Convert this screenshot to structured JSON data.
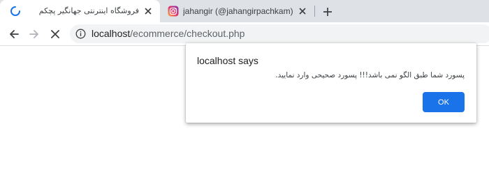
{
  "tabs": [
    {
      "title": "فروشگاه اینترنتی جهانگیر پچکم",
      "state": "loading",
      "icon": "spinner-icon"
    },
    {
      "title": "jahangir (@jahangirpachkam) • Instagram",
      "icon": "instagram-icon"
    }
  ],
  "toolbar": {
    "url_host": "localhost",
    "url_path": "/ecommerce/checkout.php",
    "icons": [
      "back-arrow-icon",
      "forward-arrow-icon",
      "stop-icon",
      "info-icon"
    ]
  },
  "dialog": {
    "title": "localhost says",
    "message": "پسورد شما طبق الگو نمی باشد!!! پسورد صحیحی وارد نمایید.",
    "ok_label": "OK"
  },
  "colors": {
    "tabstrip_bg": "#dee1e6",
    "accent": "#1a73e8",
    "omnibox_bg": "#f1f3f4"
  }
}
